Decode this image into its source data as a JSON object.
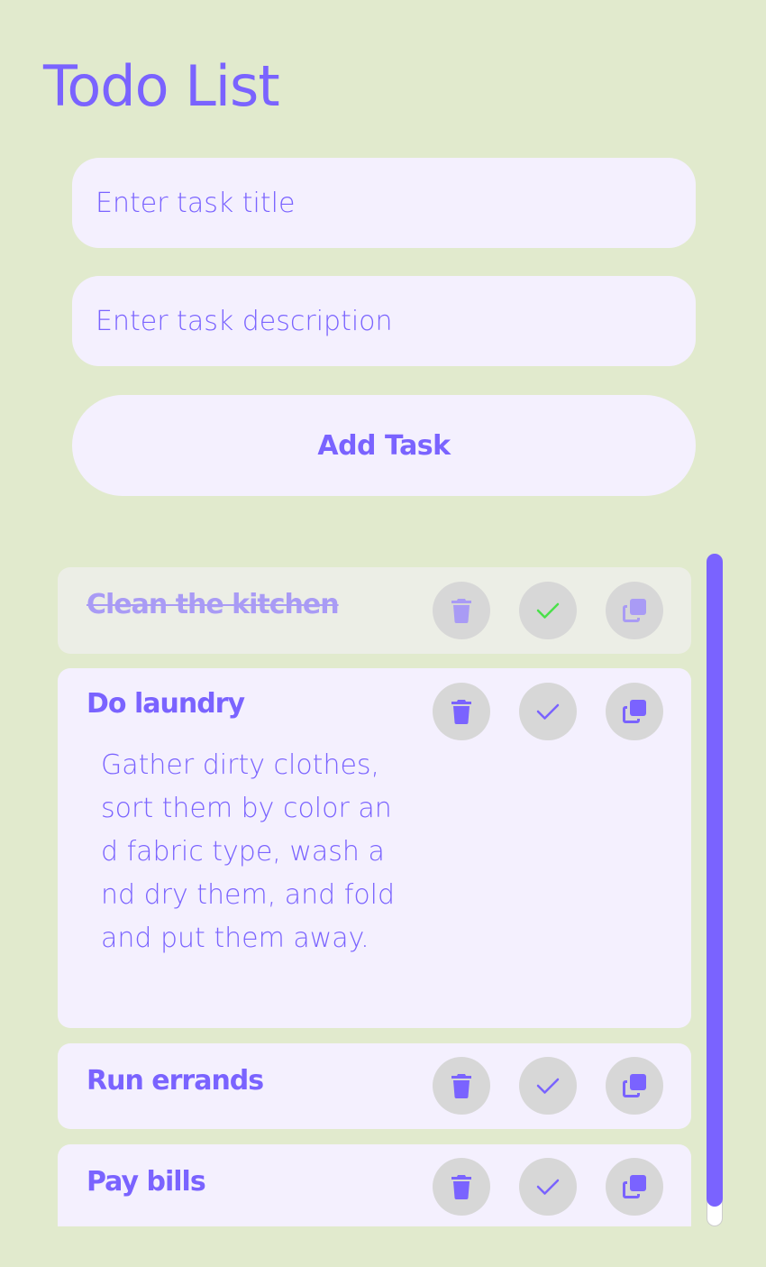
{
  "header": {
    "title": "Todo List"
  },
  "form": {
    "title_placeholder": "Enter task title",
    "title_value": "",
    "description_placeholder": "Enter task description",
    "description_value": "",
    "add_label": "Add Task"
  },
  "tasks": [
    {
      "title": "Clean the kitchen",
      "description": "",
      "completed": true
    },
    {
      "title": "Do laundry",
      "description": "Gather dirty clothes, sort them by color and fabric type, wash and dry them, and fold and put them away.",
      "completed": false
    },
    {
      "title": "Run errands",
      "description": "",
      "completed": false
    },
    {
      "title": "Pay bills",
      "description": "",
      "completed": false
    }
  ],
  "icons": {
    "delete": "trash-icon",
    "complete": "check-icon",
    "duplicate": "copy-icon"
  },
  "colors": {
    "background": "#e1eacd",
    "accent": "#7a63ff",
    "card": "#f4f0fe",
    "card_completed": "#eceee6",
    "icon_button": "#d7d7d7",
    "check_completed": "#4be04b"
  }
}
